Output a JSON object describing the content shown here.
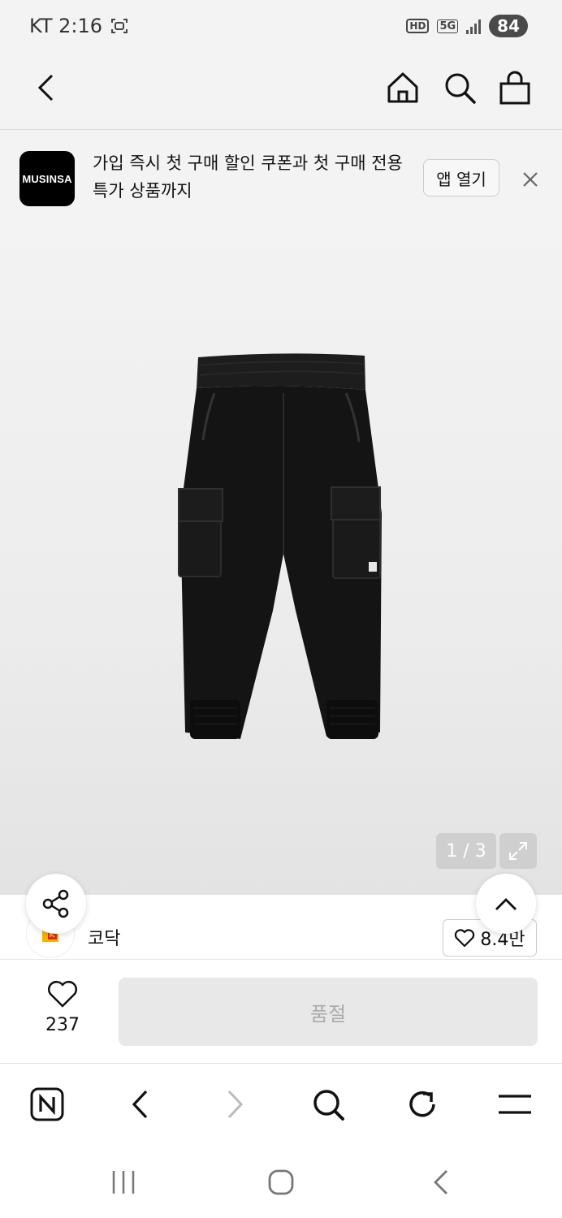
{
  "status": {
    "carrier_time": "KT 2:16",
    "hd": "HD",
    "network": "5G",
    "battery": "84"
  },
  "banner": {
    "logo_text": "MUSINSA",
    "text": "가입 즉시 첫 구매 할인 쿠폰과 첫 구매 전용 특가 상품까지",
    "open_app_label": "앱 열기"
  },
  "product": {
    "image_counter": "1 / 3"
  },
  "brand": {
    "name": "코닥",
    "likes": "8.4만"
  },
  "purchase": {
    "wish_count": "237",
    "button_label": "품절"
  },
  "colors": {
    "background": "#f3f3f3",
    "soldout_bg": "#e8e8e8",
    "kodak_yellow": "#f5b400",
    "kodak_red": "#e3262b"
  },
  "icons": [
    "back-icon",
    "home-icon",
    "search-icon",
    "bag-icon",
    "close-icon",
    "expand-icon",
    "share-icon",
    "chevron-up-icon",
    "heart-icon",
    "naver-icon",
    "reload-icon",
    "menu-icon"
  ]
}
